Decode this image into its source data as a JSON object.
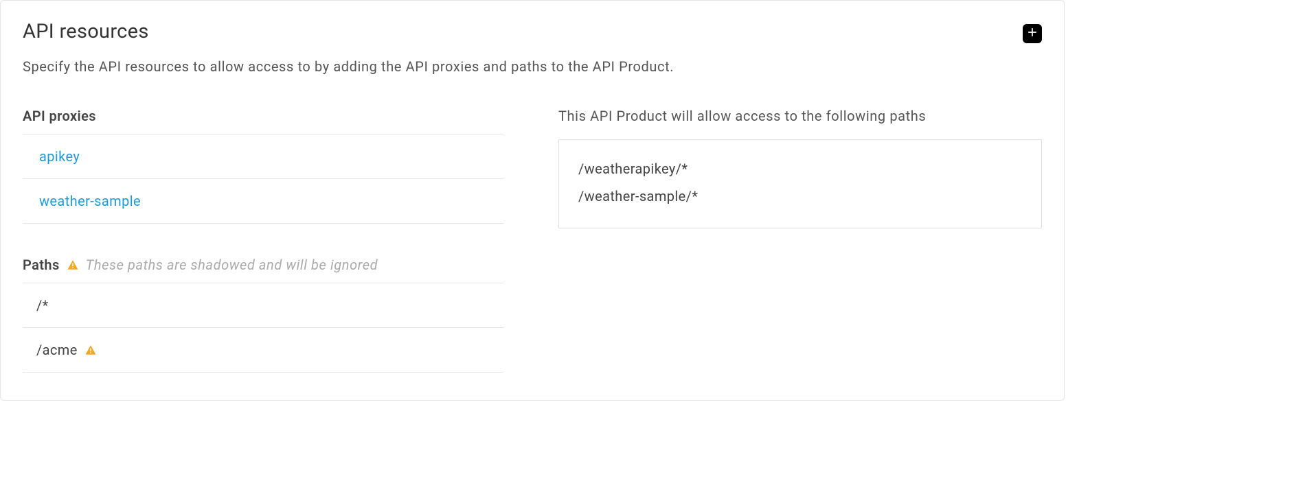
{
  "header": {
    "title": "API resources",
    "description": "Specify the API resources to allow access to by adding the API proxies and paths to the API Product."
  },
  "proxies": {
    "label": "API proxies",
    "items": [
      "apikey",
      "weather-sample"
    ]
  },
  "paths": {
    "label": "Paths",
    "warning_text": "These paths are shadowed and will be ignored",
    "items": [
      {
        "value": "/*",
        "warn": false
      },
      {
        "value": "/acme",
        "warn": true
      }
    ]
  },
  "allowed": {
    "label": "This API Product will allow access to the following paths",
    "items": [
      "/weatherapikey/*",
      "/weather-sample/*"
    ]
  }
}
